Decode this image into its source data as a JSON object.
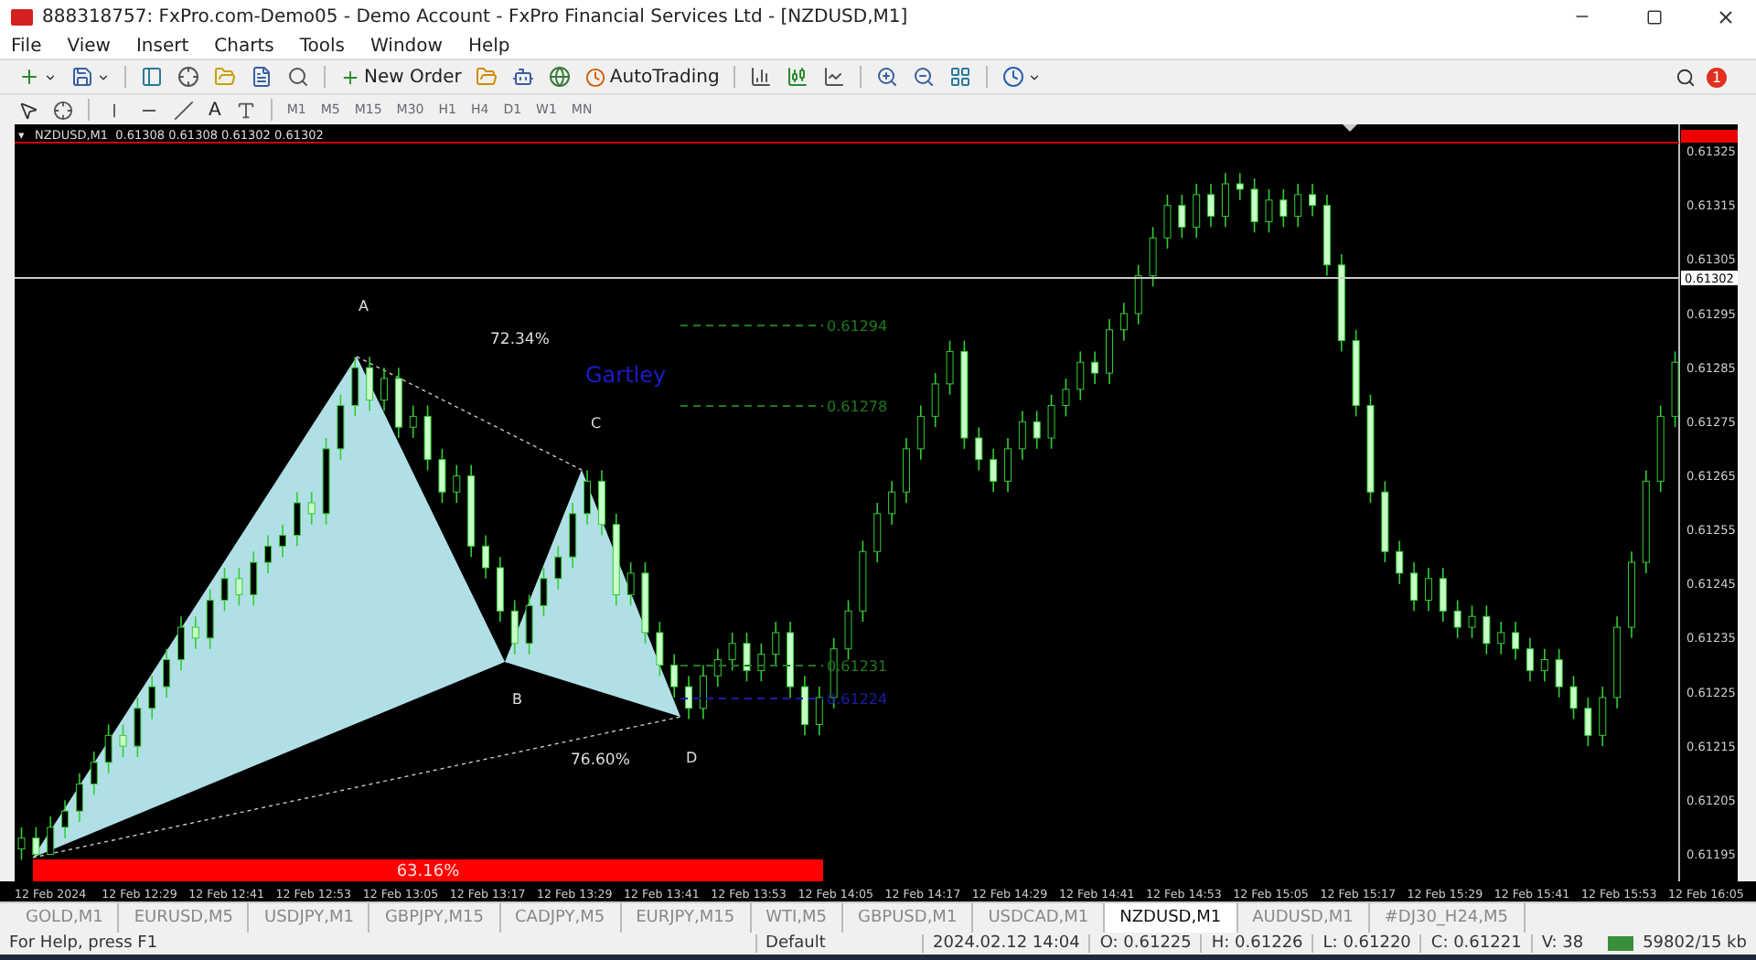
{
  "window": {
    "title": "888318757: FxPro.com-Demo05 - Demo Account - FxPro Financial Services Ltd - [NZDUSD,M1]"
  },
  "menu": [
    "File",
    "View",
    "Insert",
    "Charts",
    "Tools",
    "Window",
    "Help"
  ],
  "toolbar": {
    "new_order": "New Order",
    "auto_trading": "AutoTrading",
    "notifications": "1"
  },
  "drawing_tools": {
    "text_tool": "A"
  },
  "timeframes": [
    "M1",
    "M5",
    "M15",
    "M30",
    "H1",
    "H4",
    "D1",
    "W1",
    "MN"
  ],
  "chart": {
    "header_marker": "▾",
    "header": "NZDUSD,M1  0.61308 0.61308 0.61302 0.61302",
    "bid_label": "0.61302",
    "time_ticks": [
      "12 Feb 2024",
      "12 Feb 12:29",
      "12 Feb 12:41",
      "12 Feb 12:53",
      "12 Feb 13:05",
      "12 Feb 13:17",
      "12 Feb 13:29",
      "12 Feb 13:41",
      "12 Feb 13:53",
      "12 Feb 14:05",
      "12 Feb 14:17",
      "12 Feb 14:29",
      "12 Feb 14:41",
      "12 Feb 14:53",
      "12 Feb 15:05",
      "12 Feb 15:17",
      "12 Feb 15:29",
      "12 Feb 15:41",
      "12 Feb 15:53",
      "12 Feb 16:05"
    ],
    "pattern": {
      "name": "Gartley",
      "points": [
        "A",
        "B",
        "C",
        "D"
      ],
      "ratio_ac": "72.34%",
      "ratio_bd": "76.60%",
      "ratio_xb": "63.16%"
    },
    "levels": [
      {
        "price": "0.61294",
        "color": "#1f7a1f"
      },
      {
        "price": "0.61278",
        "color": "#1f7a1f"
      },
      {
        "price": "0.61231",
        "color": "#1f7a1f"
      },
      {
        "price": "0.61224",
        "color": "#1c1ca8"
      }
    ],
    "chart_data": {
      "type": "candlestick",
      "ylim": [
        0.6119,
        0.6133
      ],
      "yticks": [
        {
          "value": 0.61325,
          "label": "0.61325"
        },
        {
          "value": 0.61315,
          "label": "0.61315"
        },
        {
          "value": 0.61305,
          "label": "0.61305"
        },
        {
          "value": 0.61295,
          "label": "0.61295"
        },
        {
          "value": 0.61285,
          "label": "0.61285"
        },
        {
          "value": 0.61275,
          "label": "0.61275"
        },
        {
          "value": 0.61265,
          "label": "0.61265"
        },
        {
          "value": 0.61255,
          "label": "0.61255"
        },
        {
          "value": 0.61245,
          "label": "0.61245"
        },
        {
          "value": 0.61235,
          "label": "0.61235"
        },
        {
          "value": 0.61225,
          "label": "0.61225"
        },
        {
          "value": 0.61215,
          "label": "0.61215"
        },
        {
          "value": 0.61205,
          "label": "0.61205"
        },
        {
          "value": 0.61195,
          "label": "0.61195"
        }
      ],
      "ohlc": [
        [
          0.61196,
          0.612,
          0.61194,
          0.61198
        ],
        [
          0.61198,
          0.612,
          0.61195,
          0.61195
        ],
        [
          0.61195,
          0.61202,
          0.61195,
          0.612
        ],
        [
          0.612,
          0.61205,
          0.61198,
          0.61203
        ],
        [
          0.61203,
          0.6121,
          0.61201,
          0.61208
        ],
        [
          0.61208,
          0.61214,
          0.61206,
          0.61212
        ],
        [
          0.61212,
          0.61219,
          0.6121,
          0.61217
        ],
        [
          0.61217,
          0.61219,
          0.61213,
          0.61215
        ],
        [
          0.61215,
          0.61224,
          0.61213,
          0.61222
        ],
        [
          0.61222,
          0.61228,
          0.6122,
          0.61226
        ],
        [
          0.61226,
          0.61233,
          0.61224,
          0.61231
        ],
        [
          0.61231,
          0.61239,
          0.61229,
          0.61237
        ],
        [
          0.61237,
          0.61239,
          0.61233,
          0.61235
        ],
        [
          0.61235,
          0.61244,
          0.61233,
          0.61242
        ],
        [
          0.61242,
          0.61248,
          0.6124,
          0.61246
        ],
        [
          0.61246,
          0.61248,
          0.61241,
          0.61243
        ],
        [
          0.61243,
          0.61251,
          0.61241,
          0.61249
        ],
        [
          0.61249,
          0.61254,
          0.61247,
          0.61252
        ],
        [
          0.61252,
          0.61256,
          0.6125,
          0.61254
        ],
        [
          0.61254,
          0.61262,
          0.61252,
          0.6126
        ],
        [
          0.6126,
          0.61262,
          0.61256,
          0.61258
        ],
        [
          0.61258,
          0.61272,
          0.61256,
          0.6127
        ],
        [
          0.6127,
          0.6128,
          0.61268,
          0.61278
        ],
        [
          0.61278,
          0.61287,
          0.61276,
          0.61285
        ],
        [
          0.61285,
          0.61287,
          0.61277,
          0.61279
        ],
        [
          0.61279,
          0.61285,
          0.61277,
          0.61283
        ],
        [
          0.61283,
          0.61285,
          0.61272,
          0.61274
        ],
        [
          0.61274,
          0.61278,
          0.61272,
          0.61276
        ],
        [
          0.61276,
          0.61278,
          0.61266,
          0.61268
        ],
        [
          0.61268,
          0.6127,
          0.6126,
          0.61262
        ],
        [
          0.61262,
          0.61267,
          0.6126,
          0.61265
        ],
        [
          0.61265,
          0.61267,
          0.6125,
          0.61252
        ],
        [
          0.61252,
          0.61254,
          0.61246,
          0.61248
        ],
        [
          0.61248,
          0.6125,
          0.61238,
          0.6124
        ],
        [
          0.6124,
          0.61242,
          0.61232,
          0.61234
        ],
        [
          0.61234,
          0.61243,
          0.61232,
          0.61241
        ],
        [
          0.61241,
          0.61248,
          0.61239,
          0.61246
        ],
        [
          0.61246,
          0.61252,
          0.61244,
          0.6125
        ],
        [
          0.6125,
          0.6126,
          0.61248,
          0.61258
        ],
        [
          0.61258,
          0.61266,
          0.61256,
          0.61264
        ],
        [
          0.61264,
          0.61266,
          0.61254,
          0.61256
        ],
        [
          0.61256,
          0.61258,
          0.61241,
          0.61243
        ],
        [
          0.61243,
          0.61249,
          0.61241,
          0.61247
        ],
        [
          0.61247,
          0.61249,
          0.61234,
          0.61236
        ],
        [
          0.61236,
          0.61238,
          0.61228,
          0.6123
        ],
        [
          0.6123,
          0.61232,
          0.61224,
          0.61226
        ],
        [
          0.61226,
          0.61228,
          0.6122,
          0.61222
        ],
        [
          0.61222,
          0.6123,
          0.6122,
          0.61228
        ],
        [
          0.61228,
          0.61233,
          0.61226,
          0.61231
        ],
        [
          0.61231,
          0.61236,
          0.61229,
          0.61234
        ],
        [
          0.61234,
          0.61236,
          0.61227,
          0.61229
        ],
        [
          0.61229,
          0.61234,
          0.61227,
          0.61232
        ],
        [
          0.61232,
          0.61238,
          0.6123,
          0.61236
        ],
        [
          0.61236,
          0.61238,
          0.61224,
          0.61226
        ],
        [
          0.61226,
          0.61228,
          0.61217,
          0.61219
        ],
        [
          0.61219,
          0.61226,
          0.61217,
          0.61224
        ],
        [
          0.61224,
          0.61235,
          0.61222,
          0.61233
        ],
        [
          0.61233,
          0.61242,
          0.61231,
          0.6124
        ],
        [
          0.6124,
          0.61253,
          0.61238,
          0.61251
        ],
        [
          0.61251,
          0.6126,
          0.61249,
          0.61258
        ],
        [
          0.61258,
          0.61264,
          0.61256,
          0.61262
        ],
        [
          0.61262,
          0.61272,
          0.6126,
          0.6127
        ],
        [
          0.6127,
          0.61278,
          0.61268,
          0.61276
        ],
        [
          0.61276,
          0.61284,
          0.61274,
          0.61282
        ],
        [
          0.61282,
          0.6129,
          0.6128,
          0.61288
        ],
        [
          0.61288,
          0.6129,
          0.6127,
          0.61272
        ],
        [
          0.61272,
          0.61274,
          0.61266,
          0.61268
        ],
        [
          0.61268,
          0.6127,
          0.61262,
          0.61264
        ],
        [
          0.61264,
          0.61272,
          0.61262,
          0.6127
        ],
        [
          0.6127,
          0.61277,
          0.61268,
          0.61275
        ],
        [
          0.61275,
          0.61277,
          0.6127,
          0.61272
        ],
        [
          0.61272,
          0.6128,
          0.6127,
          0.61278
        ],
        [
          0.61278,
          0.61283,
          0.61276,
          0.61281
        ],
        [
          0.61281,
          0.61288,
          0.61279,
          0.61286
        ],
        [
          0.61286,
          0.61288,
          0.61282,
          0.61284
        ],
        [
          0.61284,
          0.61294,
          0.61282,
          0.61292
        ],
        [
          0.61292,
          0.61297,
          0.6129,
          0.61295
        ],
        [
          0.61295,
          0.61304,
          0.61293,
          0.61302
        ],
        [
          0.61302,
          0.61311,
          0.613,
          0.61309
        ],
        [
          0.61309,
          0.61317,
          0.61307,
          0.61315
        ],
        [
          0.61315,
          0.61317,
          0.61309,
          0.61311
        ],
        [
          0.61311,
          0.61319,
          0.61309,
          0.61317
        ],
        [
          0.61317,
          0.61319,
          0.61311,
          0.61313
        ],
        [
          0.61313,
          0.61321,
          0.61311,
          0.61319
        ],
        [
          0.61319,
          0.61321,
          0.61316,
          0.61318
        ],
        [
          0.61318,
          0.6132,
          0.6131,
          0.61312
        ],
        [
          0.61312,
          0.61318,
          0.6131,
          0.61316
        ],
        [
          0.61316,
          0.61318,
          0.61311,
          0.61313
        ],
        [
          0.61313,
          0.61319,
          0.61311,
          0.61317
        ],
        [
          0.61317,
          0.61319,
          0.61313,
          0.61315
        ],
        [
          0.61315,
          0.61317,
          0.61302,
          0.61304
        ],
        [
          0.61304,
          0.61306,
          0.61288,
          0.6129
        ],
        [
          0.6129,
          0.61292,
          0.61276,
          0.61278
        ],
        [
          0.61278,
          0.6128,
          0.6126,
          0.61262
        ],
        [
          0.61262,
          0.61264,
          0.61249,
          0.61251
        ],
        [
          0.61251,
          0.61253,
          0.61245,
          0.61247
        ],
        [
          0.61247,
          0.61249,
          0.6124,
          0.61242
        ],
        [
          0.61242,
          0.61248,
          0.6124,
          0.61246
        ],
        [
          0.61246,
          0.61248,
          0.61238,
          0.6124
        ],
        [
          0.6124,
          0.61242,
          0.61235,
          0.61237
        ],
        [
          0.61237,
          0.61241,
          0.61235,
          0.61239
        ],
        [
          0.61239,
          0.61241,
          0.61232,
          0.61234
        ],
        [
          0.61234,
          0.61238,
          0.61232,
          0.61236
        ],
        [
          0.61236,
          0.61238,
          0.61231,
          0.61233
        ],
        [
          0.61233,
          0.61235,
          0.61227,
          0.61229
        ],
        [
          0.61229,
          0.61233,
          0.61227,
          0.61231
        ],
        [
          0.61231,
          0.61233,
          0.61224,
          0.61226
        ],
        [
          0.61226,
          0.61228,
          0.6122,
          0.61222
        ],
        [
          0.61222,
          0.61224,
          0.61215,
          0.61217
        ],
        [
          0.61217,
          0.61226,
          0.61215,
          0.61224
        ],
        [
          0.61224,
          0.61239,
          0.61222,
          0.61237
        ],
        [
          0.61237,
          0.61251,
          0.61235,
          0.61249
        ],
        [
          0.61249,
          0.61266,
          0.61247,
          0.61264
        ],
        [
          0.61264,
          0.61278,
          0.61262,
          0.61276
        ],
        [
          0.61276,
          0.61288,
          0.61274,
          0.61286
        ]
      ]
    }
  },
  "tabs": [
    {
      "label": "GOLD,M1",
      "selected": false
    },
    {
      "label": "EURUSD,M5",
      "selected": false
    },
    {
      "label": "USDJPY,M1",
      "selected": false
    },
    {
      "label": "GBPJPY,M15",
      "selected": false
    },
    {
      "label": "CADJPY,M5",
      "selected": false
    },
    {
      "label": "EURJPY,M15",
      "selected": false
    },
    {
      "label": "WTI,M5",
      "selected": false
    },
    {
      "label": "GBPUSD,M1",
      "selected": false
    },
    {
      "label": "USDCAD,M1",
      "selected": false
    },
    {
      "label": "NZDUSD,M1",
      "selected": true
    },
    {
      "label": "AUDUSD,M1",
      "selected": false
    },
    {
      "label": "#DJ30_H24,M5",
      "selected": false
    }
  ],
  "status_bar": {
    "help": "For Help, press F1",
    "profile": "Default",
    "time": "2024.02.12 14:04",
    "open": "O: 0.61225",
    "high": "H: 0.61226",
    "low": "L: 0.61220",
    "close": "C: 0.61221",
    "volume": "V: 38",
    "traffic": "59802/15 kb"
  }
}
